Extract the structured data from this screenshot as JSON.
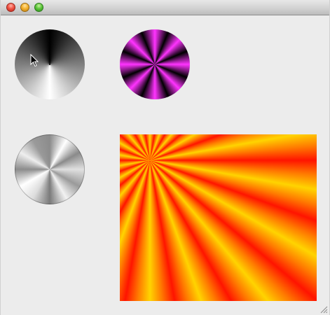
{
  "window": {
    "title_bar_buttons": [
      {
        "name": "close",
        "color": "#f25545"
      },
      {
        "name": "minimize",
        "color": "#f5b32f"
      },
      {
        "name": "zoom",
        "color": "#5cc63a"
      }
    ]
  },
  "panels": [
    {
      "name": "gray-conical-gradient",
      "shape": "circle",
      "colors": [
        "#000000",
        "#ffffff"
      ]
    },
    {
      "name": "magenta-conical-gradient",
      "shape": "circle",
      "colors": [
        "#ff33ff",
        "#000000"
      ]
    },
    {
      "name": "silver-conical-gradient",
      "shape": "circle",
      "colors": [
        "#8c8c8c",
        "#ffffff"
      ]
    },
    {
      "name": "orange-sunburst-gradient",
      "shape": "rectangle",
      "colors": [
        "#ffd400",
        "#ff7a00",
        "#ff1400"
      ]
    }
  ],
  "icons": {
    "cursor": "mouse-pointer-icon",
    "resize": "resize-grip-icon"
  }
}
